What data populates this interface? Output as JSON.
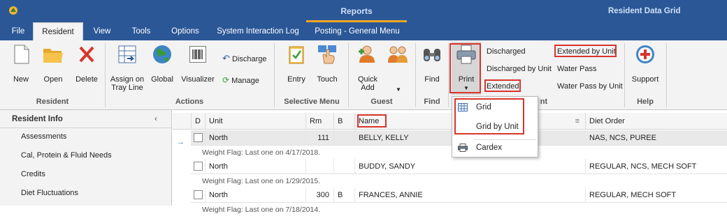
{
  "titlebar": {
    "context_tab": "Reports",
    "window_title": "Resident Data Grid",
    "accent": "#2b5797"
  },
  "menu_tabs": [
    "File",
    "Resident",
    "View",
    "Tools",
    "Options",
    "System Interaction Log",
    "Posting - General Menu"
  ],
  "ribbon": {
    "resident_group": {
      "label": "Resident",
      "new": "New",
      "open": "Open",
      "delete": "Delete"
    },
    "actions_group": {
      "label": "Actions",
      "assign": "Assign on Tray Line",
      "global": "Global",
      "visualizer": "Visualizer",
      "discharge": "Discharge",
      "manage": "Manage"
    },
    "selective_group": {
      "label": "Selective Menu",
      "entry": "Entry",
      "touch": "Touch"
    },
    "guest_group": {
      "label": "Guest",
      "quick_add": "Quick Add"
    },
    "find_group": {
      "label": "Find",
      "find": "Find"
    },
    "print_group": {
      "print": "Print",
      "label_tail": "nt",
      "discharged": "Discharged",
      "discharged_by_unit": "Discharged by Unit",
      "extended": "Extended",
      "extended_by_unit": "Extended by Unit",
      "water_pass": "Water Pass",
      "water_pass_by_unit": "Water Pass by Unit"
    },
    "help_group": {
      "label": "Help",
      "support": "Support"
    }
  },
  "left_panel": {
    "title": "Resident Info",
    "chevron": "‹",
    "items": [
      "Assessments",
      "Cal, Protein & Fluid Needs",
      "Credits",
      "Diet Fluctuations"
    ]
  },
  "grid": {
    "columns": {
      "d": "D",
      "unit": "Unit",
      "rm": "Rm",
      "b": "B",
      "name": "Name",
      "diet": "Diet Order"
    },
    "rows": [
      {
        "unit": "North",
        "rm": "111",
        "b": "",
        "name": "BELLY, KELLY",
        "diet": "NAS, NCS, PUREE",
        "flag": "Weight Flag: Last one on 4/17/2018."
      },
      {
        "unit": "North",
        "rm": "",
        "b": "",
        "name": "BUDDY, SANDY",
        "diet": "REGULAR, NCS, MECH SOFT",
        "flag": "Weight Flag: Last one on 1/29/2015."
      },
      {
        "unit": "North",
        "rm": "300",
        "b": "B",
        "name": "FRANCES, ANNIE",
        "diet": "REGULAR, MECH SOFT",
        "flag": "Weight Flag: Last one on 7/18/2014."
      }
    ]
  },
  "print_dropdown": {
    "items": [
      "Grid",
      "Grid by Unit",
      "Cardex"
    ]
  },
  "highlight_color": "#d9342b"
}
